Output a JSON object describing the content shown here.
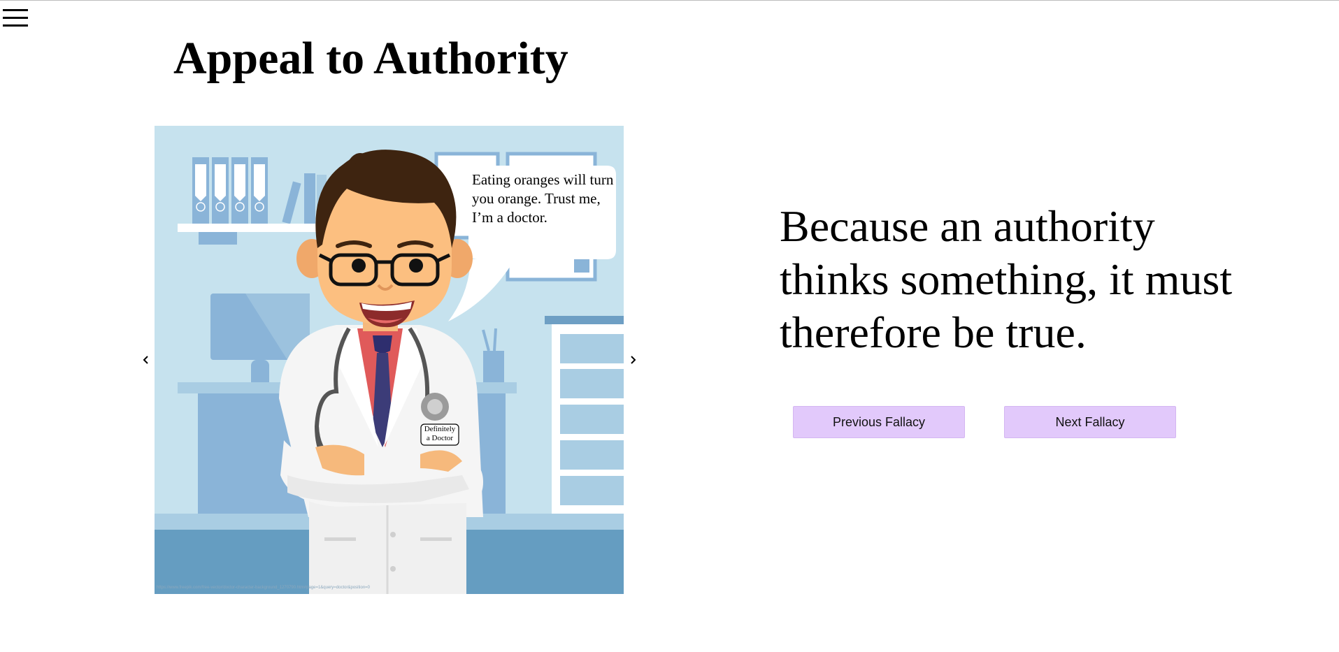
{
  "header": {
    "menu_icon": "hamburger-menu-icon"
  },
  "page": {
    "title": "Appeal to Authority",
    "definition": "Because an authority thinks something, it must therefore be true."
  },
  "carousel": {
    "prev_icon": "chevron-left-icon",
    "next_icon": "chevron-right-icon",
    "speech_bubble_text": "Eating oranges will turn you orange. Trust me, I’m a doctor.",
    "badge_text": "Definitely a Doctor",
    "image_credit": "https://www.freepik.com/free-vector/doctor-character-background_1270790.htm#page=1&query=doctor&position=0"
  },
  "actions": {
    "previous_label": "Previous Fallacy",
    "next_label": "Next Fallacy"
  },
  "colors": {
    "button_bg": "#e2c9fb",
    "scene_bg": "#c6e2ee",
    "floor": "#659dc1"
  }
}
